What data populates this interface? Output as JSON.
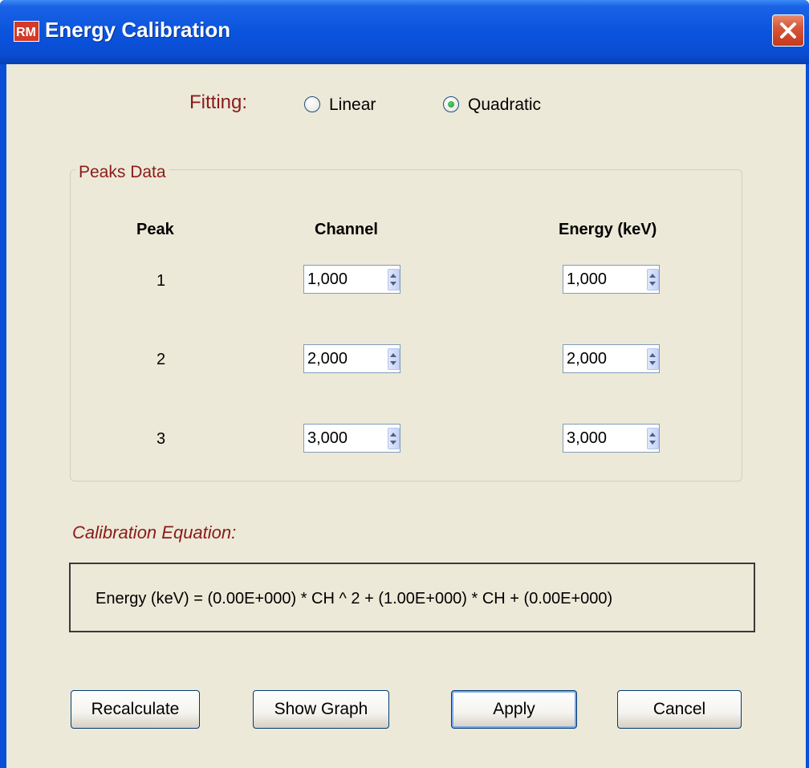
{
  "window": {
    "title": "Energy Calibration",
    "app_icon": "RM",
    "close_icon": "close-icon"
  },
  "fitting": {
    "label": "Fitting:",
    "options": [
      {
        "label": "Linear",
        "selected": false
      },
      {
        "label": "Quadratic",
        "selected": true
      }
    ]
  },
  "peaks": {
    "group_title": "Peaks Data",
    "headers": [
      "Peak",
      "Channel",
      "Energy (keV)"
    ],
    "rows": [
      {
        "peak": "1",
        "channel": "1,000",
        "energy": "1,000"
      },
      {
        "peak": "2",
        "channel": "2,000",
        "energy": "2,000"
      },
      {
        "peak": "3",
        "channel": "3,000",
        "energy": "3,000"
      }
    ]
  },
  "equation": {
    "label": "Calibration Equation:",
    "text": "Energy (keV) = (0.00E+000) * CH ^ 2 +  (1.00E+000) * CH + (0.00E+000)"
  },
  "buttons": {
    "recalculate": "Recalculate",
    "show_graph": "Show Graph",
    "apply": "Apply",
    "cancel": "Cancel"
  },
  "colors": {
    "title_bar": "#0a54dd",
    "accent_label": "#8b1a1a",
    "dialog_bg": "#ece9d8"
  }
}
